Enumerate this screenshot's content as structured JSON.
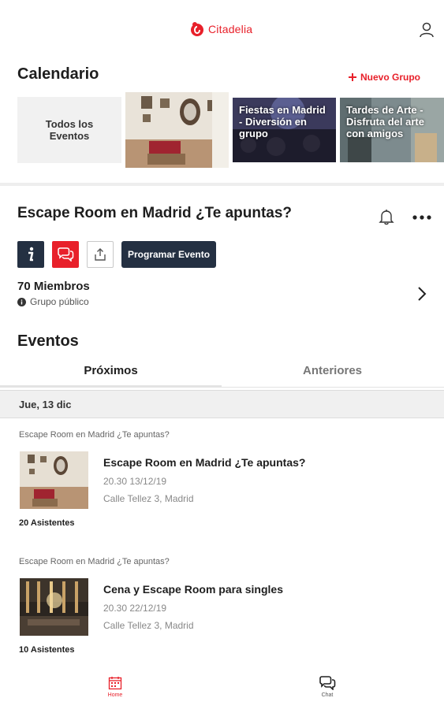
{
  "header": {
    "logo_text": "Citadelia",
    "brand_color": "#e8202a",
    "user_icon": "user-icon"
  },
  "calendar": {
    "title": "Calendario",
    "new_group_label": "Nuevo Grupo",
    "cards": [
      {
        "label": "Todos los Eventos"
      },
      {
        "label": ""
      },
      {
        "label": "Fiestas en Madrid - Diversión en grupo"
      },
      {
        "label": "Tardes de Arte - Disfruta del arte con amigos"
      }
    ]
  },
  "group": {
    "title": "Escape Room en Madrid ¿Te apuntas?",
    "program_label": "Programar Evento",
    "members": "70 Miembros",
    "visibility": "Grupo público",
    "accent_dark": "#243042"
  },
  "events": {
    "title": "Eventos",
    "tabs": [
      {
        "label": "Próximos",
        "active": true
      },
      {
        "label": "Anteriores",
        "active": false
      }
    ],
    "date_label": "Jue, 13 dic",
    "items": [
      {
        "group": "Escape Room en Madrid ¿Te apuntas?",
        "name": "Escape Room en Madrid ¿Te apuntas?",
        "when": "20.30  13/12/19",
        "where": "Calle Tellez 3, Madrid",
        "attendees": "20 Asistentes"
      },
      {
        "group": "Escape Room en Madrid ¿Te apuntas?",
        "name": "Cena y Escape Room para singles",
        "when": "20.30  22/12/19",
        "where": "Calle Tellez 3, Madrid",
        "attendees": "10 Asistentes"
      }
    ]
  },
  "nav": {
    "home_label": "Home",
    "chat_label": "Chat"
  }
}
